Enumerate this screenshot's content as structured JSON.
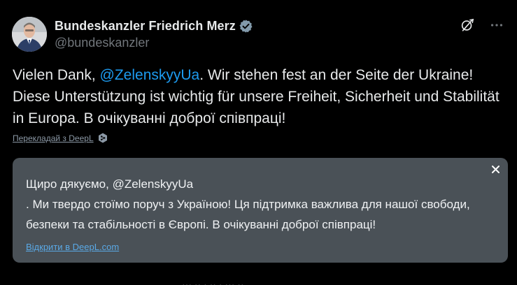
{
  "post": {
    "display_name": "Bundeskanzler Friedrich Merz",
    "handle": "@bundeskanzler",
    "text_before_mention": "Vielen Dank, ",
    "mention": "@ZelenskyyUa",
    "text_after_mention": ". Wir stehen fest an der Seite der Ukraine! Diese Unterstützung ist wichtig für unsere Freiheit, Sicherheit und Stabilität in Europa. В очікуванні доброї співпраці!",
    "timestamp_partial": "··· ·· · ·· · ··· ··"
  },
  "translate": {
    "link_label": "Перекладай з DeepL"
  },
  "translation": {
    "line1": "Щиро дякуємо, @ZelenskyyUa",
    "line2": ". Ми твердо стоїмо поруч з Україною! Ця підтримка важлива для нашої свободи, безпеки та стабільності в Європі. В очікуванні доброї співпраці!",
    "open_label": "Відкрити в DeepL.com"
  },
  "icons": {
    "verified": "verified-badge-icon",
    "grok": "grok-icon",
    "more": "more-icon",
    "deepl": "deepl-icon",
    "close": "close-icon"
  },
  "colors": {
    "background": "#000000",
    "text": "#e7e9ea",
    "secondary": "#71767b",
    "accent": "#1d9bf0",
    "card": "#4a5157",
    "link": "#5aa9e6"
  }
}
